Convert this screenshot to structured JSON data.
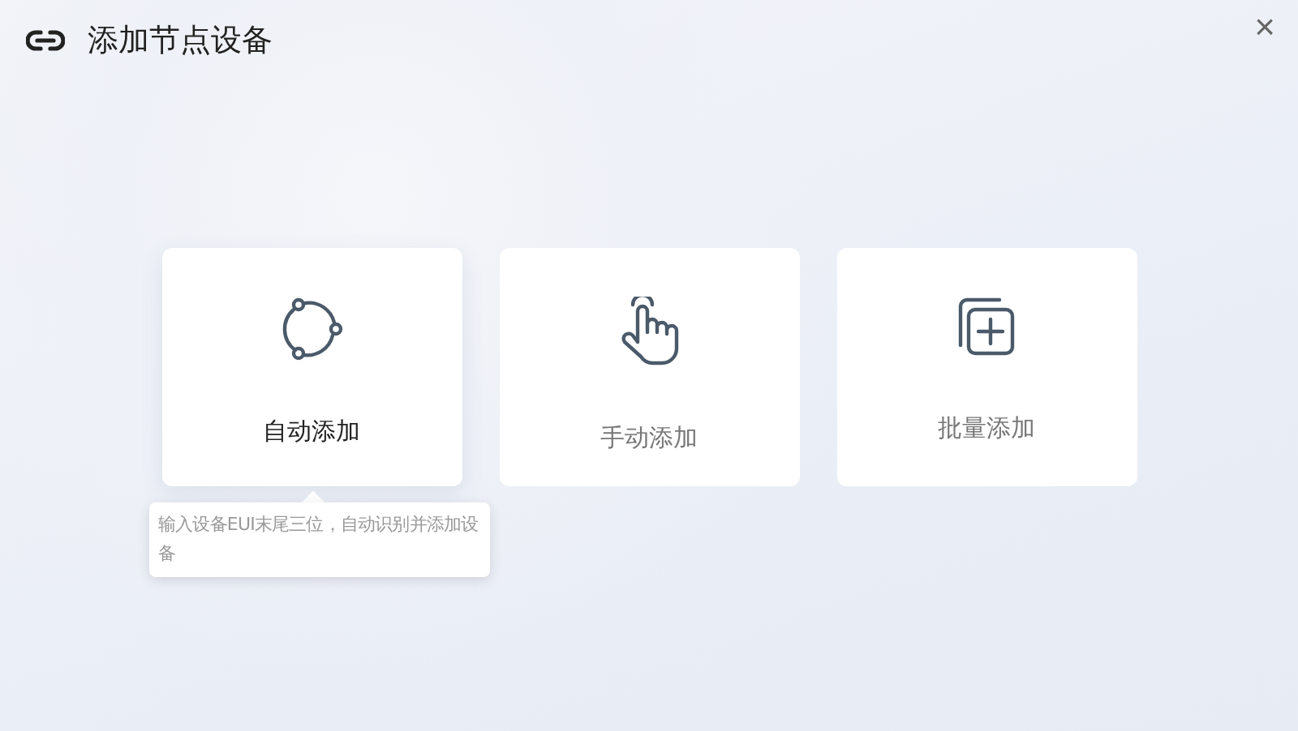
{
  "dialog": {
    "title": "添加节点设备",
    "close": "×"
  },
  "options": [
    {
      "kind": "auto",
      "label": "自动添加",
      "selected": true,
      "tooltip": "输入设备EUI末尾三位，自动识别并添加设备"
    },
    {
      "kind": "manual",
      "label": "手动添加",
      "selected": false
    },
    {
      "kind": "batch",
      "label": "批量添加",
      "selected": false
    }
  ]
}
